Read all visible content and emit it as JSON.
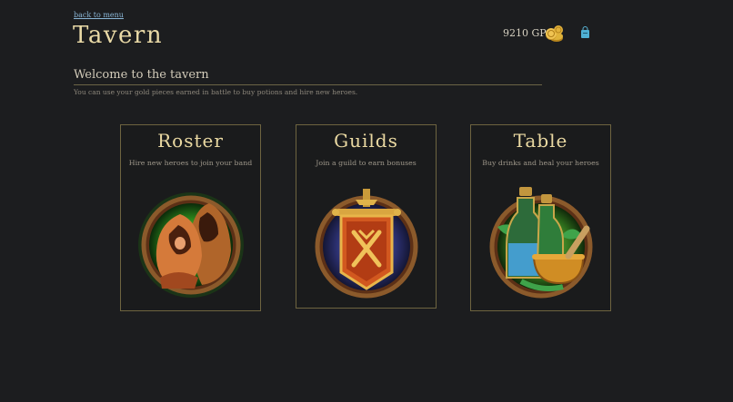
{
  "nav": {
    "back_label": "back to menu"
  },
  "header": {
    "title": "Tavern",
    "gold_text": "9210 GP"
  },
  "welcome": {
    "title": "Welcome to the tavern",
    "text": "You can use your gold pieces earned in battle to buy potions and hire new heroes."
  },
  "cards": [
    {
      "title": "Roster",
      "text": "Hire new heroes to join your band",
      "icon": "hooded-heroes-icon"
    },
    {
      "title": "Guilds",
      "text": "Join a guild to earn bonuses",
      "icon": "guild-banner-icon"
    },
    {
      "title": "Table",
      "text": "Buy drinks and heal your heroes",
      "icon": "potion-bottles-icon"
    }
  ],
  "colors": {
    "background": "#1c1d1f",
    "gold_accent": "#e9d9a6",
    "link": "#8ab6d6",
    "card_border": "#6e6440"
  }
}
